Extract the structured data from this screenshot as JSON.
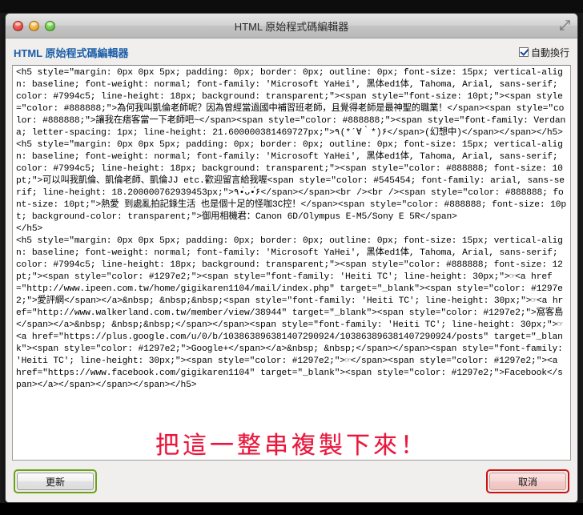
{
  "window": {
    "title": "HTML 原始程式碼編輯器",
    "controls": {
      "close_label": "",
      "minimize_label": "",
      "maximize_label": ""
    },
    "resize_icon": "resize-handle-icon"
  },
  "dialog": {
    "heading_html": "HTML",
    "heading": "HTML 原始程式碼編輯器",
    "wrap_checkbox": {
      "label": "自動換行",
      "checked": true
    }
  },
  "editor": {
    "code": "<h5 style=\"margin: 0px 0px 5px; padding: 0px; border: 0px; outline: 0px; font-size: 15px; vertical-align: baseline; font-weight: normal; font-family: 'Microsoft YaHei', 黑体ed1体, Tahoma, Arial, sans-serif; color: #7994c5; line-height: 18px; background: transparent;\"><span style=\"font-size: 10pt;\"><span style=\"color: #888888;\">為何我叫凱倫老師呢？因為曾經當過國中補習班老師，且覺得老師是最神聖的職業！</span><span style=\"color: #888888;\">讓我在痞客當一下老師吧~</span><span style=\"color: #888888;\"><span style=\"font-family: Verdana; letter-spacing: 1px; line-height: 21.600000381469727px;\">٩(*´∀｀*)۶</span>(幻想中)</span></span></h5>\n<h5 style=\"margin: 0px 0px 5px; padding: 0px; border: 0px; outline: 0px; font-size: 15px; vertical-align: baseline; font-weight: normal; font-family: 'Microsoft YaHei', 黑体ed1体, Tahoma, Arial, sans-serif; color: #7994c5; line-height: 18px; background: transparent;\"><span style=\"color: #888888; font-size: 10pt;\">可以叫我凱倫、凱倫老師、凱倫JJ etc.歡迎留言給我喔<span style=\"color: #545454; font-family: arial, sans-serif; line-height: 18.200000762939453px;\">٩•̀ᴗ•́۶</span></span><br /><br /><span style=\"color: #888888; font-size: 10pt;\">熱愛 到處亂拍記錄生活 也是個十足的怪咖3C控！</span><span style=\"color: #888888; font-size: 10pt; background-color: transparent;\">御用相機君：Canon 6D/Olympus E-M5/Sony E 5R</span>\n</h5>\n<h5 style=\"margin: 0px 0px 5px; padding: 0px; border: 0px; outline: 0px; font-size: 15px; vertical-align: baseline; font-weight: normal; font-family: 'Microsoft YaHei', 黑体ed1体, Tahoma, Arial, sans-serif; color: #7994c5; line-height: 18px; background: transparent;\"><span style=\"color: #888888; font-size: 12pt;\"><span style=\"color: #1297e2;\"><span style=\"font-family: 'Heiti TC'; line-height: 30px;\">☞<a href=\"http://www.ipeen.com.tw/home/gigikaren1104/mail/index.php\" target=\"_blank\"><span style=\"color: #1297e2;\">愛評網</span></a>&nbsp; &nbsp;&nbsp;<span style=\"font-family: 'Heiti TC'; line-height: 30px;\">☞<a href=\"http://www.walkerland.com.tw/member/view/38944\" target=\"_blank\"><span style=\"color: #1297e2;\">窩客島</span></a>&nbsp; &nbsp;&nbsp;</span></span><span style=\"font-family: 'Heiti TC'; line-height: 30px;\">☞<a href=\"https://plus.google.com/u/0/b/103863896381407290924/103863896381407290924/posts\" target=\"_blank\"><span style=\"color: #1297e2;\">Google+</span></a>&nbsp; &nbsp;</span></span><span style=\"font-family: 'Heiti TC'; line-height: 30px;\"><span style=\"color: #1297e2;\">☞</span><span style=\"color: #1297e2;\"><a href=\"https://www.facebook.com/gigikaren1104\" target=\"_blank\"><span style=\"color: #1297e2;\">Facebook</span></a></span></span></span></h5>"
  },
  "annotation": {
    "text": "把這一整串複製下來！",
    "color": "#e8173d"
  },
  "footer": {
    "update_label": "更新",
    "cancel_label": "取消",
    "update_outline_color": "#6aa316",
    "cancel_outline_color": "#cc1111"
  }
}
